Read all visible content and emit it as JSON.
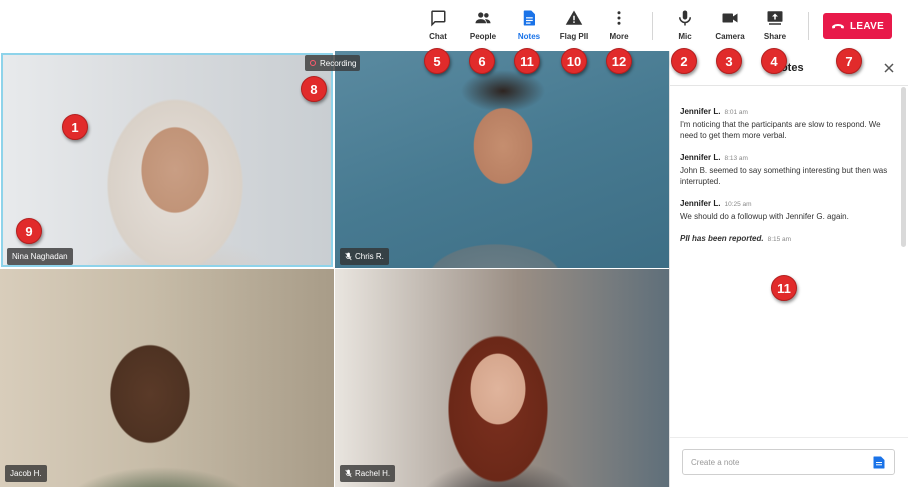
{
  "toolbar": {
    "chat": {
      "label": "Chat",
      "icon": "chat-bubble-icon"
    },
    "people": {
      "label": "People",
      "icon": "people-icon"
    },
    "notes": {
      "label": "Notes",
      "icon": "notes-icon",
      "active": true
    },
    "flag_pii": {
      "label": "Flag PII",
      "icon": "warning-triangle-icon"
    },
    "more": {
      "label": "More",
      "icon": "vertical-dots-icon"
    },
    "mic": {
      "label": "Mic",
      "icon": "microphone-icon"
    },
    "camera": {
      "label": "Camera",
      "icon": "video-camera-icon"
    },
    "share": {
      "label": "Share",
      "icon": "share-screen-icon"
    },
    "leave": {
      "label": "LEAVE",
      "icon": "phone-hangup-icon"
    }
  },
  "recording": {
    "label": "Recording"
  },
  "participants": [
    {
      "name": "Nina Naghadan",
      "muted": false,
      "active_speaker": true
    },
    {
      "name": "Chris R.",
      "muted": true,
      "active_speaker": false
    },
    {
      "name": "Jacob H.",
      "muted": false,
      "active_speaker": false
    },
    {
      "name": "Rachel H.",
      "muted": true,
      "active_speaker": false
    }
  ],
  "notes_panel": {
    "title": "Notes",
    "notes": [
      {
        "author": "Jennifer L.",
        "time": "8:01 am",
        "text": "I'm noticing that the participants are slow to respond. We need to get them more verbal."
      },
      {
        "author": "Jennifer L.",
        "time": "8:13 am",
        "text": "John B. seemed to say something interesting but then was interrupted."
      },
      {
        "author": "Jennifer L.",
        "time": "10:25 am",
        "text": "We should do a followup with Jennifer G. again."
      }
    ],
    "system_note": {
      "text": "PII has been reported.",
      "time": "8:15 am"
    },
    "input_placeholder": "Create a note"
  },
  "callouts": [
    "1",
    "2",
    "3",
    "4",
    "5",
    "6",
    "7",
    "8",
    "9",
    "10",
    "11",
    "11",
    "12"
  ],
  "colors": {
    "accent": "#1a73e8",
    "leave": "#e8194a",
    "callout": "#e12b2b",
    "active_tile_border": "#8ed3ea"
  }
}
